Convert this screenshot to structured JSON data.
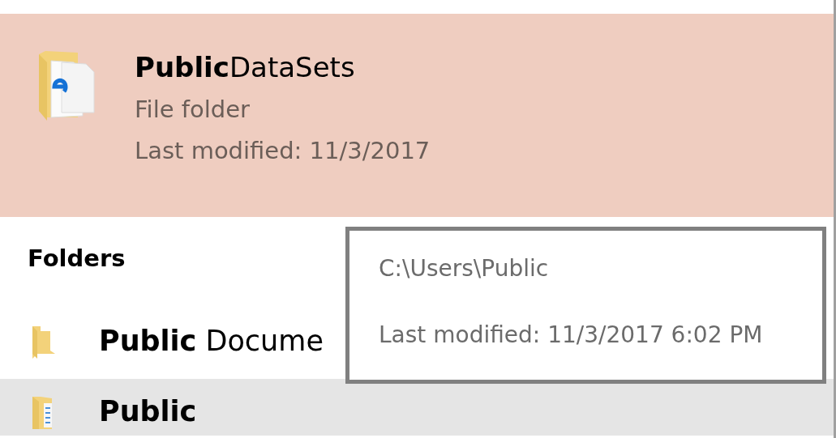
{
  "best_match": {
    "title": "**Public**DataSets",
    "type": "File folder",
    "modified": "Last modified: 11/3/2017",
    "selected": true
  },
  "folders": {
    "heading": "Folders",
    "items": [
      {
        "name": "**Public** Docume",
        "kind": "plain",
        "selected": false
      },
      {
        "name": "**Public**",
        "kind": "documents",
        "selected": true
      }
    ]
  },
  "tooltip": {
    "path": "C:\\Users\\Public",
    "modified": "Last modified: 11/3/2017 6:02 PM"
  }
}
